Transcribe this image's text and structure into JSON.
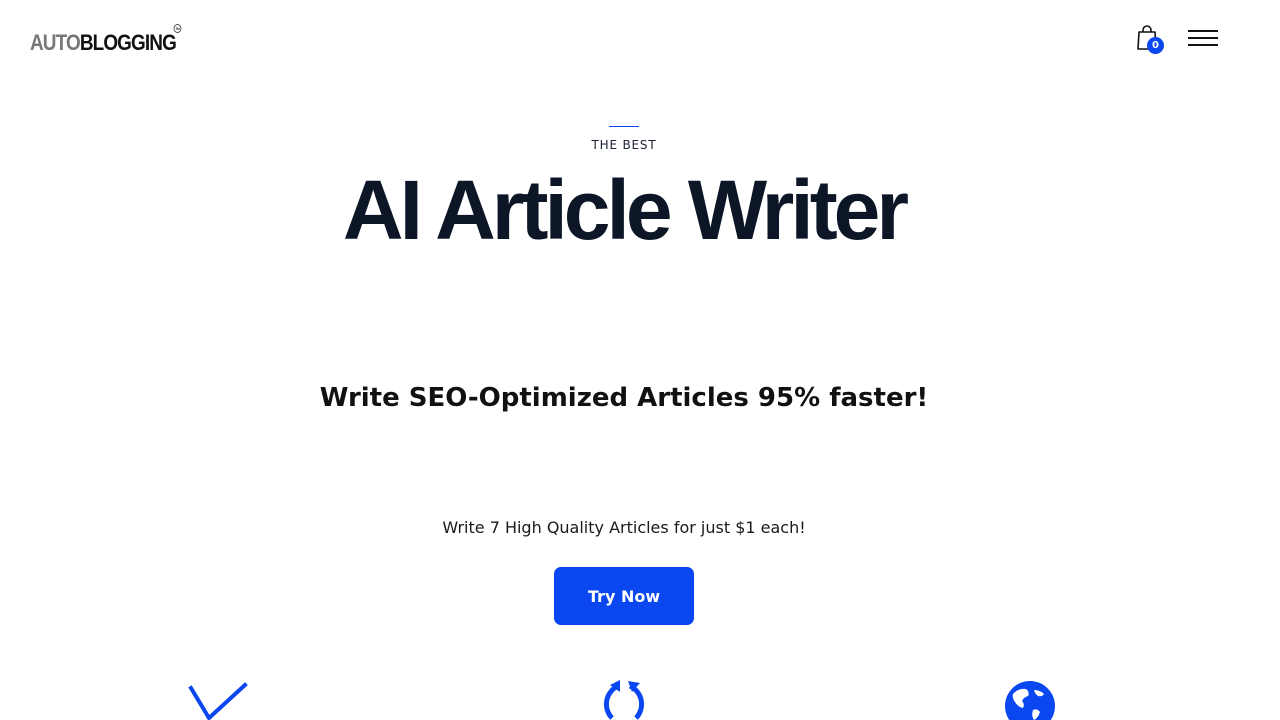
{
  "header": {
    "logo": {
      "part_a": "AUTO",
      "part_b": "BLOGGING",
      "trademark": "TM"
    },
    "cart_count": "0"
  },
  "hero": {
    "eyebrow": "THE BEST",
    "title": "AI Article Writer",
    "subtitle": "Write SEO-Optimized Articles 95% faster!",
    "tagline": "Write 7 High Quality Articles for just $1 each!",
    "cta_label": "Try Now"
  },
  "features": {
    "icons": [
      "check-icon",
      "refresh-icon",
      "globe-icon"
    ]
  },
  "colors": {
    "accent": "#0b47f0",
    "heading": "#0d1626",
    "background": "#ffffff"
  }
}
